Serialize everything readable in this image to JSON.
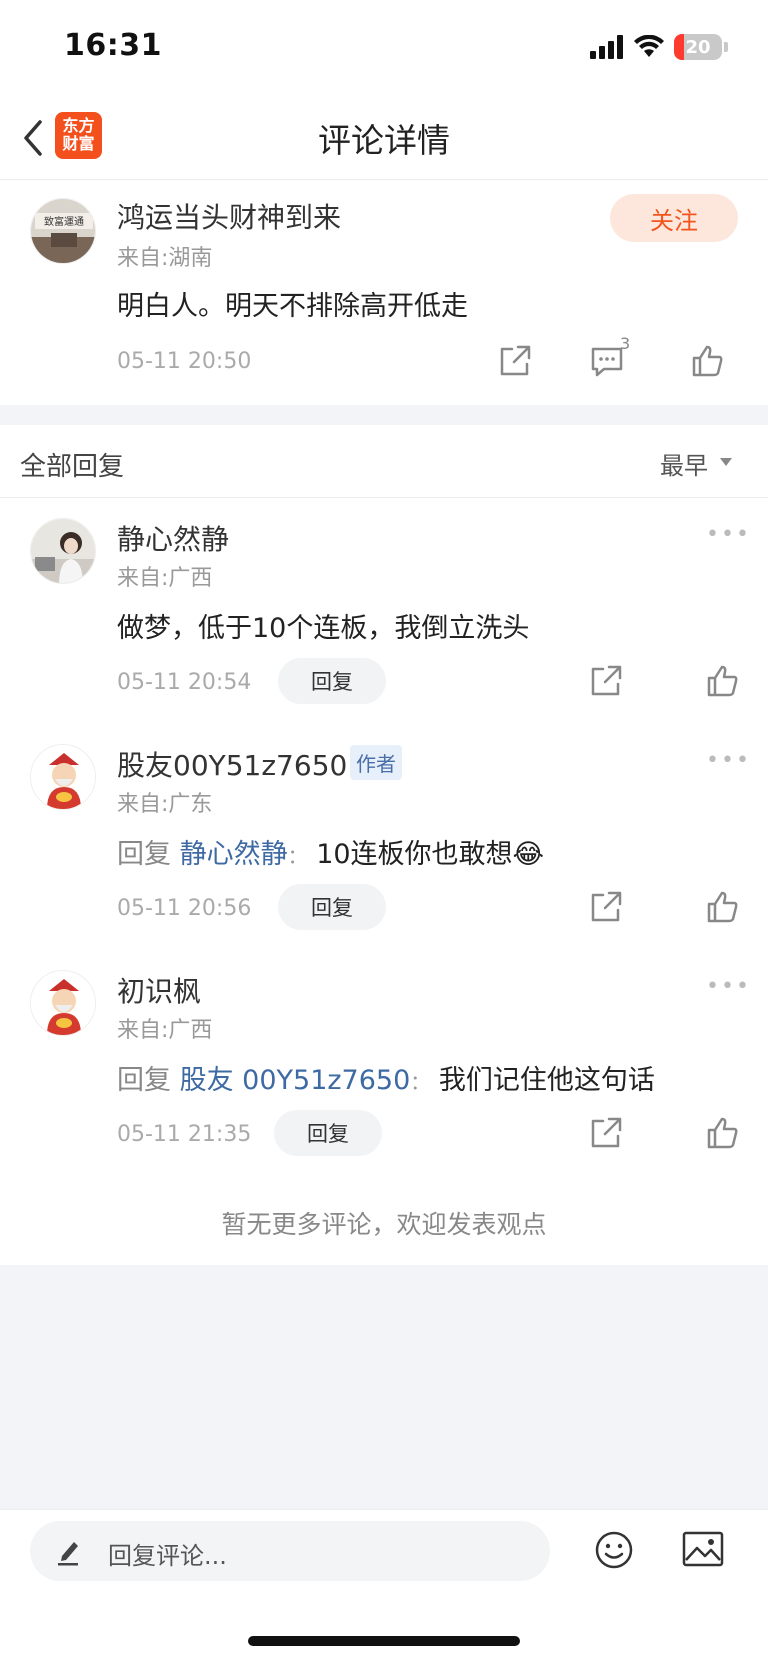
{
  "status_bar": {
    "time": "16:31",
    "battery": "20"
  },
  "nav": {
    "title": "评论详情",
    "logo_line1": "东方",
    "logo_line2": "财富",
    "back_icon": "chevron-left-icon"
  },
  "main_comment": {
    "username": "鸿运当头财神到来",
    "from": "来自:湖南",
    "follow_label": "关注",
    "text": "明白人。明天不排除高开低走",
    "time": "05-11 20:50",
    "reply_count": "3"
  },
  "replies_header": {
    "title": "全部回复",
    "sort_label": "最早"
  },
  "replies": [
    {
      "username": "静心然静",
      "from": "来自:广西",
      "text": "做梦，低于10个连板，我倒立洗头",
      "time": "05-11 20:54",
      "reply_label": "回复"
    },
    {
      "username": "股友00Y51z7650",
      "badge": "作者",
      "from": "来自:广东",
      "reply_prefix": "回复",
      "reply_target": "静心然静",
      "colon": "：",
      "text": "10连板你也敢想😂",
      "time": "05-11 20:56",
      "reply_label": "回复"
    },
    {
      "username": "初识枫",
      "from": "来自:广西",
      "reply_prefix": "回复",
      "reply_target": "股友 00Y51z7650",
      "colon": "：",
      "text": "我们记住他这句话",
      "time": "05-11 21:35",
      "reply_label": "回复"
    }
  ],
  "footer": {
    "no_more": "暂无更多评论，欢迎发表观点"
  },
  "input_bar": {
    "placeholder": "回复评论..."
  },
  "colors": {
    "brand": "#f4501e",
    "link": "#3e6aa3",
    "follow_bg": "#fde7dc"
  }
}
